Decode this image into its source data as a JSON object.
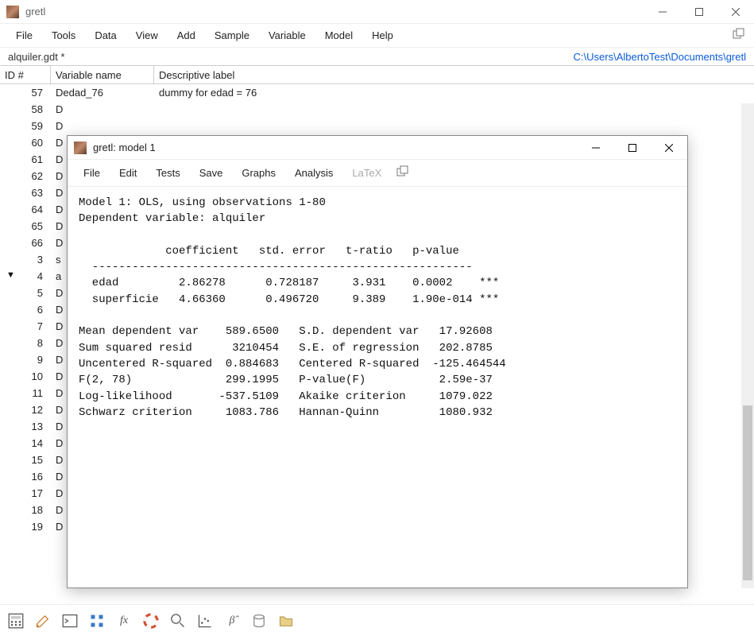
{
  "main": {
    "title": "gretl",
    "menu": [
      "File",
      "Tools",
      "Data",
      "View",
      "Add",
      "Sample",
      "Variable",
      "Model",
      "Help"
    ],
    "filename": "alquiler.gdt *",
    "path": "C:\\Users\\AlbertoTest\\Documents\\gretl",
    "columns": {
      "id": "ID #",
      "var": "Variable name",
      "lab": "Descriptive label"
    },
    "rows": [
      {
        "id": "57",
        "mark": "",
        "var": "Dedad_76",
        "lab": "dummy for edad = 76"
      },
      {
        "id": "58",
        "mark": "",
        "var": "D",
        "lab": ""
      },
      {
        "id": "59",
        "mark": "",
        "var": "D",
        "lab": ""
      },
      {
        "id": "60",
        "mark": "",
        "var": "D",
        "lab": ""
      },
      {
        "id": "61",
        "mark": "",
        "var": "D",
        "lab": ""
      },
      {
        "id": "62",
        "mark": "",
        "var": "D",
        "lab": ""
      },
      {
        "id": "63",
        "mark": "",
        "var": "D",
        "lab": ""
      },
      {
        "id": "64",
        "mark": "",
        "var": "D",
        "lab": ""
      },
      {
        "id": "65",
        "mark": "",
        "var": "D",
        "lab": ""
      },
      {
        "id": "66",
        "mark": "",
        "var": "D",
        "lab": ""
      },
      {
        "id": "3",
        "mark": "",
        "var": "s",
        "lab": ""
      },
      {
        "id": "4",
        "mark": "tri",
        "var": "a",
        "lab": ""
      },
      {
        "id": "5",
        "mark": "",
        "var": "D",
        "lab": ""
      },
      {
        "id": "6",
        "mark": "",
        "var": "D",
        "lab": ""
      },
      {
        "id": "7",
        "mark": "",
        "var": "D",
        "lab": ""
      },
      {
        "id": "8",
        "mark": "",
        "var": "D",
        "lab": ""
      },
      {
        "id": "9",
        "mark": "",
        "var": "D",
        "lab": ""
      },
      {
        "id": "10",
        "mark": "",
        "var": "D",
        "lab": ""
      },
      {
        "id": "11",
        "mark": "",
        "var": "D",
        "lab": ""
      },
      {
        "id": "12",
        "mark": "",
        "var": "D",
        "lab": ""
      },
      {
        "id": "13",
        "mark": "",
        "var": "D",
        "lab": ""
      },
      {
        "id": "14",
        "mark": "",
        "var": "D",
        "lab": ""
      },
      {
        "id": "15",
        "mark": "",
        "var": "D",
        "lab": ""
      },
      {
        "id": "16",
        "mark": "",
        "var": "D",
        "lab": ""
      },
      {
        "id": "17",
        "mark": "",
        "var": "D",
        "lab": ""
      },
      {
        "id": "18",
        "mark": "",
        "var": "D",
        "lab": ""
      },
      {
        "id": "19",
        "mark": "",
        "var": "D",
        "lab": ""
      }
    ]
  },
  "modal": {
    "title": "gretl: model 1",
    "menu": [
      "File",
      "Edit",
      "Tests",
      "Save",
      "Graphs",
      "Analysis"
    ],
    "menu_disabled": "LaTeX",
    "header1": "Model 1: OLS, using observations 1-80",
    "header2": "Dependent variable: alquiler",
    "coef_header": "             coefficient   std. error   t-ratio   p-value ",
    "coef_div": "  ---------------------------------------------------------",
    "coef_rows": [
      "  edad         2.86278      0.728187     3.931    0.0002    ***",
      "  superficie   4.66360      0.496720     9.389    1.90e-014 ***"
    ],
    "stats": [
      "Mean dependent var    589.6500   S.D. dependent var   17.92608",
      "Sum squared resid      3210454   S.E. of regression   202.8785",
      "Uncentered R-squared  0.884683   Centered R-squared  -125.464544",
      "F(2, 78)              299.1995   P-value(F)           2.59e-37",
      "Log-likelihood       -537.5109   Akaike criterion     1079.022",
      "Schwarz criterion     1083.786   Hannan-Quinn         1080.932"
    ]
  },
  "toolbar": {
    "beta": "β̂",
    "fx": "fx"
  }
}
